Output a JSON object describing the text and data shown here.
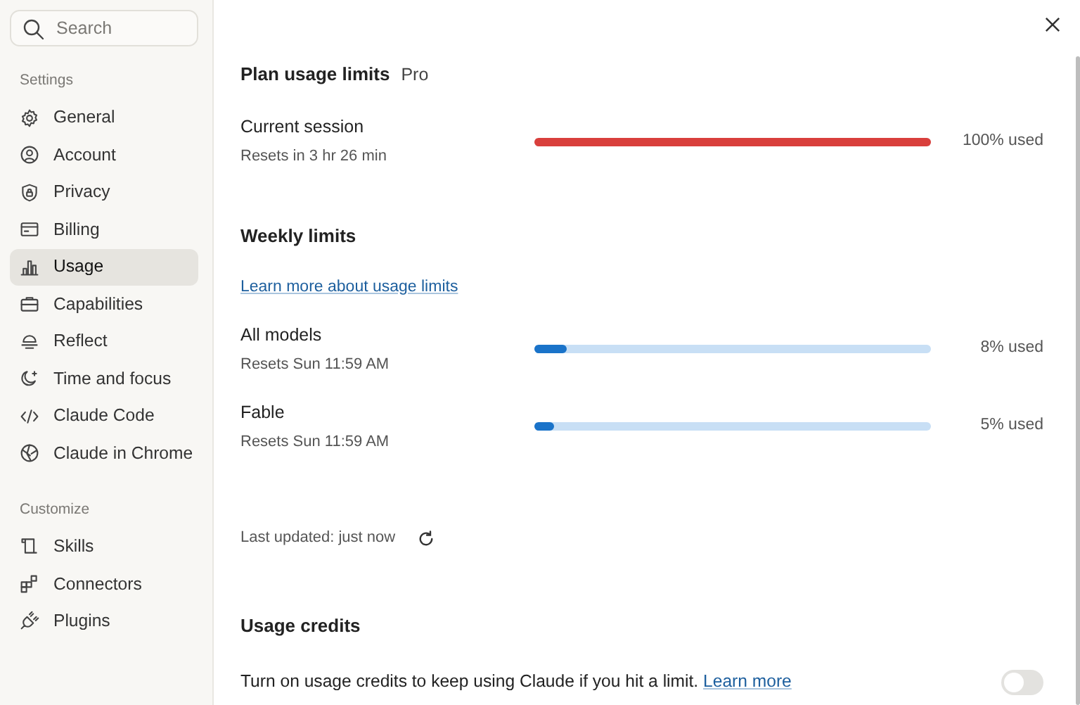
{
  "sidebar": {
    "search": {
      "placeholder": "Search"
    },
    "sections": [
      {
        "title": "Settings",
        "items": [
          {
            "label": "General",
            "selected": false
          },
          {
            "label": "Account",
            "selected": false
          },
          {
            "label": "Privacy",
            "selected": false
          },
          {
            "label": "Billing",
            "selected": false
          },
          {
            "label": "Usage",
            "selected": true
          },
          {
            "label": "Capabilities",
            "selected": false
          },
          {
            "label": "Reflect",
            "selected": false
          },
          {
            "label": "Time and focus",
            "selected": false
          },
          {
            "label": "Claude Code",
            "selected": false
          },
          {
            "label": "Claude in Chrome",
            "selected": false
          }
        ]
      },
      {
        "title": "Customize",
        "items": [
          {
            "label": "Skills",
            "selected": false
          },
          {
            "label": "Connectors",
            "selected": false
          },
          {
            "label": "Plugins",
            "selected": false
          }
        ]
      }
    ]
  },
  "plan": {
    "title": "Plan usage limits",
    "badge": "Pro",
    "limits": [
      {
        "name": "Current session",
        "resets": "Resets in 3 hr 26 min",
        "level": 1.0,
        "reading": "100% used",
        "color": "#d93f3c"
      }
    ]
  },
  "weekly": {
    "title": "Weekly limits",
    "link": "Learn more about usage limits",
    "limits": [
      {
        "name": "All models",
        "resets": "Resets Sun 11:59 AM",
        "level": 0.08,
        "reading": "8% used",
        "color": "#1a73c9"
      },
      {
        "name": "Fable",
        "resets": "Resets Sun 11:59 AM",
        "level": 0.05,
        "reading": "5% used",
        "color": "#1a73c9"
      }
    ]
  },
  "last_updated": "Last updated: just now",
  "credits": {
    "title": "Usage credits",
    "text": "Turn on usage credits to keep using Claude if you hit a limit.",
    "link": "Learn more",
    "on": false
  }
}
